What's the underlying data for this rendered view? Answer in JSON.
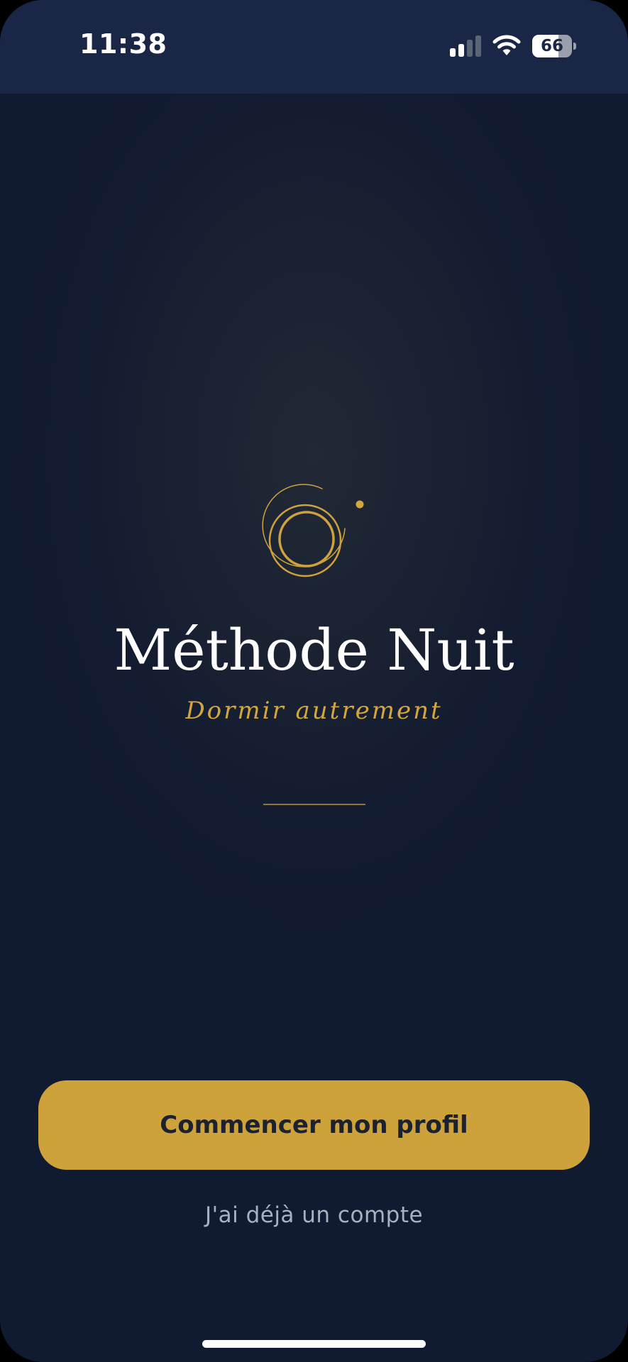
{
  "status_bar": {
    "time": "11:38",
    "battery_level": "66",
    "signal_bars_active": 2,
    "signal_bars_total": 4,
    "icons": [
      "cellular-signal-icon",
      "wifi-icon",
      "battery-icon"
    ]
  },
  "branding": {
    "logo_icon": "moon-orbit-logo",
    "app_title": "Méthode Nuit",
    "tagline": "Dormir autrement"
  },
  "actions": {
    "start_label": "Commencer mon profil",
    "login_label": "J'ai déjà un compte"
  },
  "colors": {
    "background": "#101a31",
    "status_bar": "#1a2646",
    "accent_gold": "#cea23b",
    "title_text": "#ffffff",
    "secondary_text": "#a9b0bf"
  }
}
